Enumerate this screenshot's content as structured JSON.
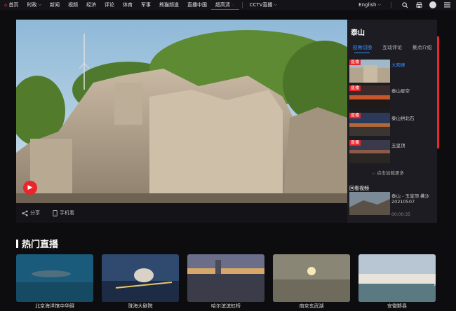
{
  "nav": {
    "items": [
      {
        "label": "首页",
        "icon": "home-icon"
      },
      {
        "label": "时政",
        "dropdown": true
      },
      {
        "label": "新闻"
      },
      {
        "label": "视频"
      },
      {
        "label": "经济"
      },
      {
        "label": "评论"
      },
      {
        "label": "体育"
      },
      {
        "label": "军事"
      },
      {
        "label": "熊猫频道"
      },
      {
        "label": "直播中国"
      },
      {
        "label": "超高清",
        "dropdown": true
      }
    ],
    "cctv_live": "CCTV直播",
    "language": "English",
    "accent": "#e8262b"
  },
  "player": {
    "share": "分享",
    "mobile": "手机看"
  },
  "side": {
    "title": "泰山",
    "tabs": [
      "视角切换",
      "互动评论",
      "景点介绍"
    ],
    "live_badge": "直播",
    "videos": [
      {
        "label": "大观峰",
        "active": true
      },
      {
        "label": "泰山星空"
      },
      {
        "label": "泰山拱北石"
      },
      {
        "label": "玉皇顶"
      }
    ],
    "expand": "点击加载更多",
    "recent_head": "回看视频",
    "recent": {
      "title": "泰山 - 玉皇顶 拂沙 20210507",
      "time": "00:00:35"
    }
  },
  "hot": {
    "title": "热门直播",
    "cards": [
      {
        "label": "北京海洋馆中华鲟"
      },
      {
        "label": "珠海大剧院"
      },
      {
        "label": "哈尔滨滨虹桥"
      },
      {
        "label": "南京玄武湖"
      },
      {
        "label": "安徽黟县"
      }
    ]
  },
  "colors": {
    "link": "#3a8bff",
    "bg": "#0d0d0f"
  }
}
